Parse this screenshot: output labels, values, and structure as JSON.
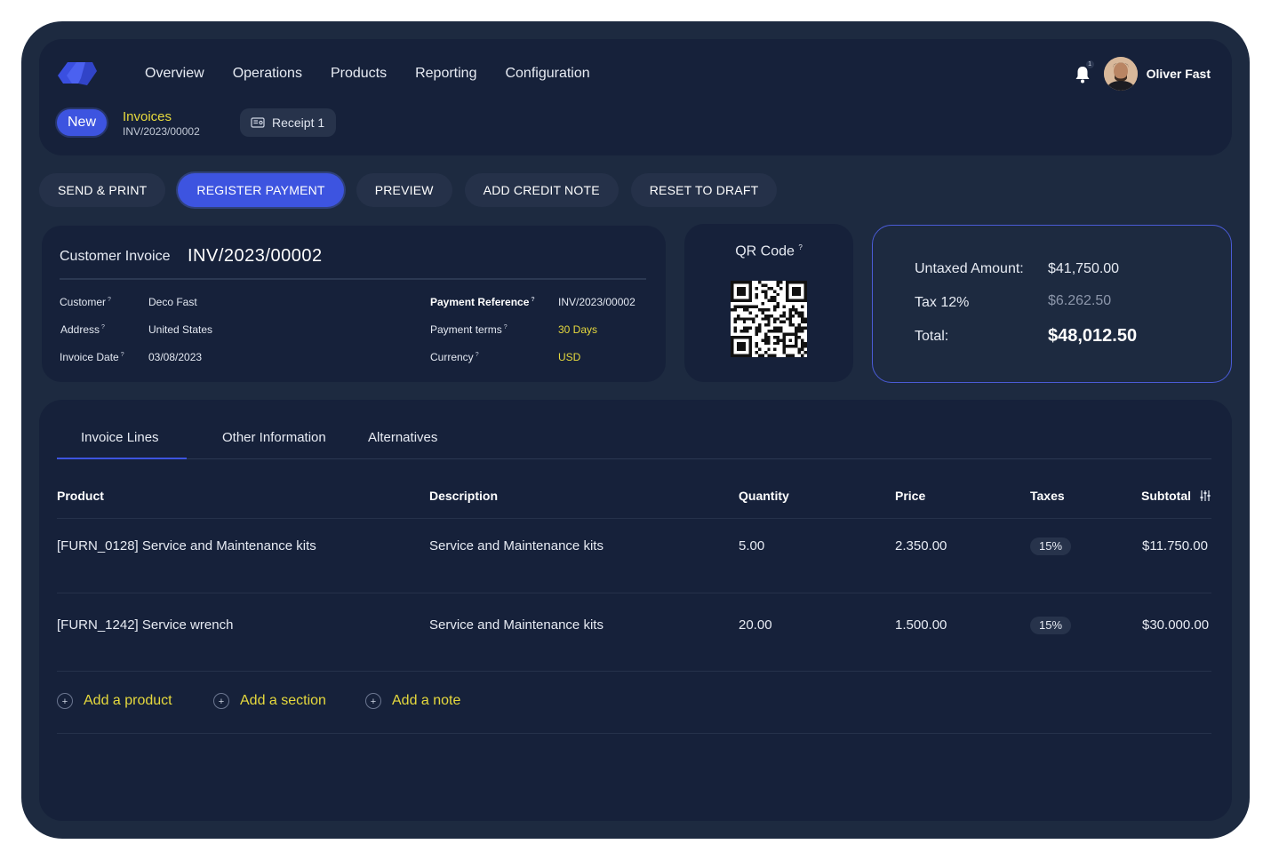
{
  "nav": {
    "items": [
      "Overview",
      "Operations",
      "Products",
      "Reporting",
      "Configuration"
    ]
  },
  "user": {
    "name": "Oliver Fast",
    "notification_count": "1"
  },
  "status": {
    "label": "New"
  },
  "breadcrumb": {
    "title": "Invoices",
    "subtitle": "INV/2023/00002"
  },
  "receipt": {
    "label": "Receipt 1"
  },
  "actions": {
    "send_print": "SEND & PRINT",
    "register_payment": "REGISTER PAYMENT",
    "preview": "PREVIEW",
    "add_credit_note": "ADD CREDIT NOTE",
    "reset_to_draft": "RESET TO DRAFT"
  },
  "invoice": {
    "label": "Customer Invoice",
    "number": "INV/2023/00002",
    "customer_label": "Customer",
    "customer": "Deco Fast",
    "address_label": "Address",
    "address": "United States",
    "date_label": "Invoice Date",
    "date": "03/08/2023",
    "payment_ref_label": "Payment Reference",
    "payment_ref": "INV/2023/00002",
    "payment_terms_label": "Payment terms",
    "payment_terms": "30 Days",
    "currency_label": "Currency",
    "currency": "USD",
    "help_mark": "?"
  },
  "qr": {
    "label": "QR Code"
  },
  "totals": {
    "untaxed_label": "Untaxed Amount:",
    "untaxed": "$41,750.00",
    "tax_label": "Tax 12%",
    "tax": "$6.262.50",
    "total_label": "Total:",
    "total": "$48,012.50"
  },
  "tabs": [
    "Invoice Lines",
    "Other Information",
    "Alternatives"
  ],
  "table": {
    "headers": [
      "Product",
      "Description",
      "Quantity",
      "Price",
      "Taxes",
      "Subtotal"
    ],
    "rows": [
      [
        "[FURN_0128] Service and Maintenance kits",
        "Service and Maintenance kits",
        "5.00",
        "2.350.00",
        "15%",
        "$11.750.00"
      ],
      [
        "[FURN_1242] Service wrench",
        "Service and Maintenance kits",
        "20.00",
        "1.500.00",
        "15%",
        "$30.000.00"
      ]
    ]
  },
  "add_links": {
    "product": "Add a product",
    "section": "Add a section",
    "note": "Add a note"
  },
  "colors": {
    "accent": "#3d54e0",
    "highlight": "#e6d93d",
    "background": "#1d2a40",
    "panel": "#16213a"
  }
}
